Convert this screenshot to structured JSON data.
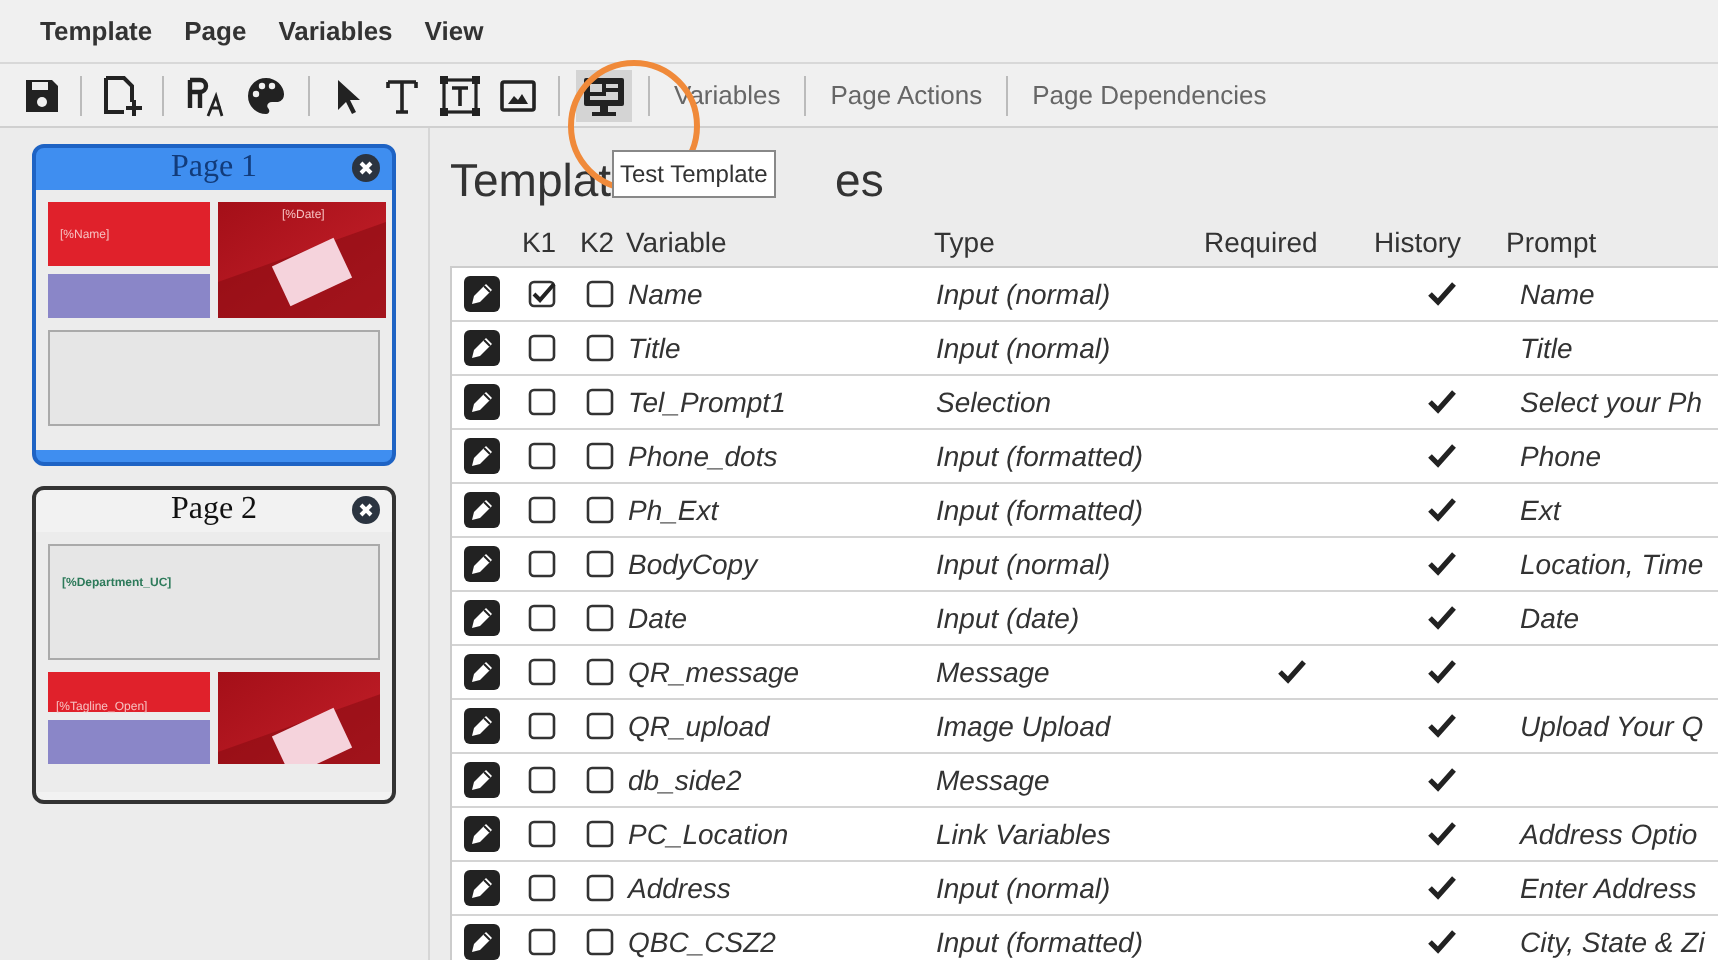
{
  "menu": [
    "Template",
    "Page",
    "Variables",
    "View"
  ],
  "toolbar": {
    "tabs": [
      {
        "label": "Variables",
        "selected": false
      },
      {
        "label": "Page Actions",
        "selected": false
      },
      {
        "label": "Page Dependencies",
        "selected": false
      }
    ],
    "tooltip": "Test Template"
  },
  "pages": [
    {
      "title": "Page 1",
      "selected": true,
      "labels": [
        "[%Name]",
        "[%Date]"
      ]
    },
    {
      "title": "Page 2",
      "selected": false,
      "labels": [
        "[%Department_UC]",
        "[%Tagline_Open]"
      ]
    }
  ],
  "heading": [
    "Templat",
    "es"
  ],
  "table": {
    "columns": [
      "K1",
      "K2",
      "Variable",
      "Type",
      "Required",
      "History",
      "Prompt"
    ],
    "rows": [
      {
        "k1": true,
        "k2": false,
        "variable": "Name",
        "type": "Input (normal)",
        "required": false,
        "history": true,
        "prompt": "Name"
      },
      {
        "k1": false,
        "k2": false,
        "variable": "Title",
        "type": "Input (normal)",
        "required": false,
        "history": false,
        "prompt": "Title"
      },
      {
        "k1": false,
        "k2": false,
        "variable": "Tel_Prompt1",
        "type": "Selection",
        "required": false,
        "history": true,
        "prompt": "Select your Ph"
      },
      {
        "k1": false,
        "k2": false,
        "variable": "Phone_dots",
        "type": "Input (formatted)",
        "required": false,
        "history": true,
        "prompt": "Phone"
      },
      {
        "k1": false,
        "k2": false,
        "variable": "Ph_Ext",
        "type": "Input (formatted)",
        "required": false,
        "history": true,
        "prompt": "Ext"
      },
      {
        "k1": false,
        "k2": false,
        "variable": "BodyCopy",
        "type": "Input (normal)",
        "required": false,
        "history": true,
        "prompt": "Location, Time"
      },
      {
        "k1": false,
        "k2": false,
        "variable": "Date",
        "type": "Input (date)",
        "required": false,
        "history": true,
        "prompt": "Date"
      },
      {
        "k1": false,
        "k2": false,
        "variable": "QR_message",
        "type": "Message",
        "required": true,
        "history": true
      },
      {
        "k1": false,
        "k2": false,
        "variable": "QR_upload",
        "type": "Image Upload",
        "required": false,
        "history": true,
        "prompt": "Upload Your Q"
      },
      {
        "k1": false,
        "k2": false,
        "variable": "db_side2",
        "type": "Message",
        "required": false,
        "history": true
      },
      {
        "k1": false,
        "k2": false,
        "variable": "PC_Location",
        "type": "Link Variables",
        "required": false,
        "history": true,
        "prompt": "Address Optio"
      },
      {
        "k1": false,
        "k2": false,
        "variable": "Address",
        "type": "Input (normal)",
        "required": false,
        "history": true,
        "prompt": "Enter Address"
      },
      {
        "k1": false,
        "k2": false,
        "variable": "QBC_CSZ2",
        "type": "Input (formatted)",
        "required": false,
        "history": true,
        "prompt": "City, State & Zi"
      }
    ]
  }
}
